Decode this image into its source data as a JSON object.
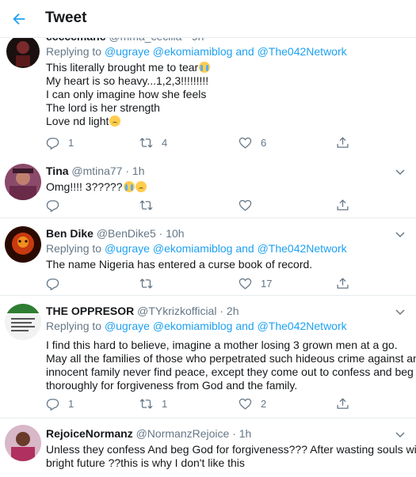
{
  "header": {
    "title": "Tweet"
  },
  "tweets": [
    {
      "name": "cccccmanc",
      "handle": "@mma_cecilia",
      "time": "9h",
      "replying_prefix": "Replying to",
      "mentions": [
        "@ugraye",
        "@ekomiamiblog",
        "@The042Network"
      ],
      "and_word": "and",
      "lines": [
        "This literally brought me to tear",
        "My heart is so heavy...1,2,3!!!!!!!!!",
        "I can only imagine how she feels",
        "The lord is her strength",
        "Love nd light"
      ],
      "counts": {
        "reply": "1",
        "retweet": "4",
        "like": "6"
      }
    },
    {
      "name": "Tina",
      "handle": "@mtina77",
      "time": "1h",
      "lines": [
        "Omg!!!! 3?????"
      ],
      "counts": {
        "reply": "",
        "retweet": "",
        "like": ""
      }
    },
    {
      "name": "Ben Dike",
      "handle": "@BenDike5",
      "time": "10h",
      "replying_prefix": "Replying to",
      "mentions": [
        "@ugraye",
        "@ekomiamiblog",
        "@The042Network"
      ],
      "and_word": "and",
      "lines": [
        "The name Nigeria has entered a curse book of record."
      ],
      "counts": {
        "reply": "",
        "retweet": "",
        "like": "17"
      }
    },
    {
      "name": "THE OPPRESOR",
      "handle": "@TYkrizkofficial",
      "time": "2h",
      "replying_prefix": "Replying to",
      "mentions": [
        "@ugraye",
        "@ekomiamiblog",
        "@The042Network"
      ],
      "and_word": "and",
      "lines": [
        "I find this hard to believe, imagine a mother losing 3 grown men at a go.",
        "May all the families of those who perpetrated such hideous crime against an",
        "innocent family never find peace, except they come out to confess and beg",
        "thoroughly for forgiveness from God and the family."
      ],
      "counts": {
        "reply": "1",
        "retweet": "1",
        "like": "2"
      }
    },
    {
      "name": "RejoiceNormanz",
      "handle": "@NormanzRejoice",
      "time": "1h",
      "lines": [
        "Unless they confess And beg God for forgiveness??? After wasting souls with",
        "bright future ??this is why I don't like this"
      ]
    }
  ],
  "separator": "·",
  "icons": [
    "back-arrow-icon",
    "reply-icon",
    "retweet-icon",
    "like-icon",
    "share-icon",
    "more-icon"
  ],
  "colors": {
    "accent": "#1da1f2",
    "muted": "#657786",
    "text": "#14171a",
    "border": "#e6ecf0"
  }
}
